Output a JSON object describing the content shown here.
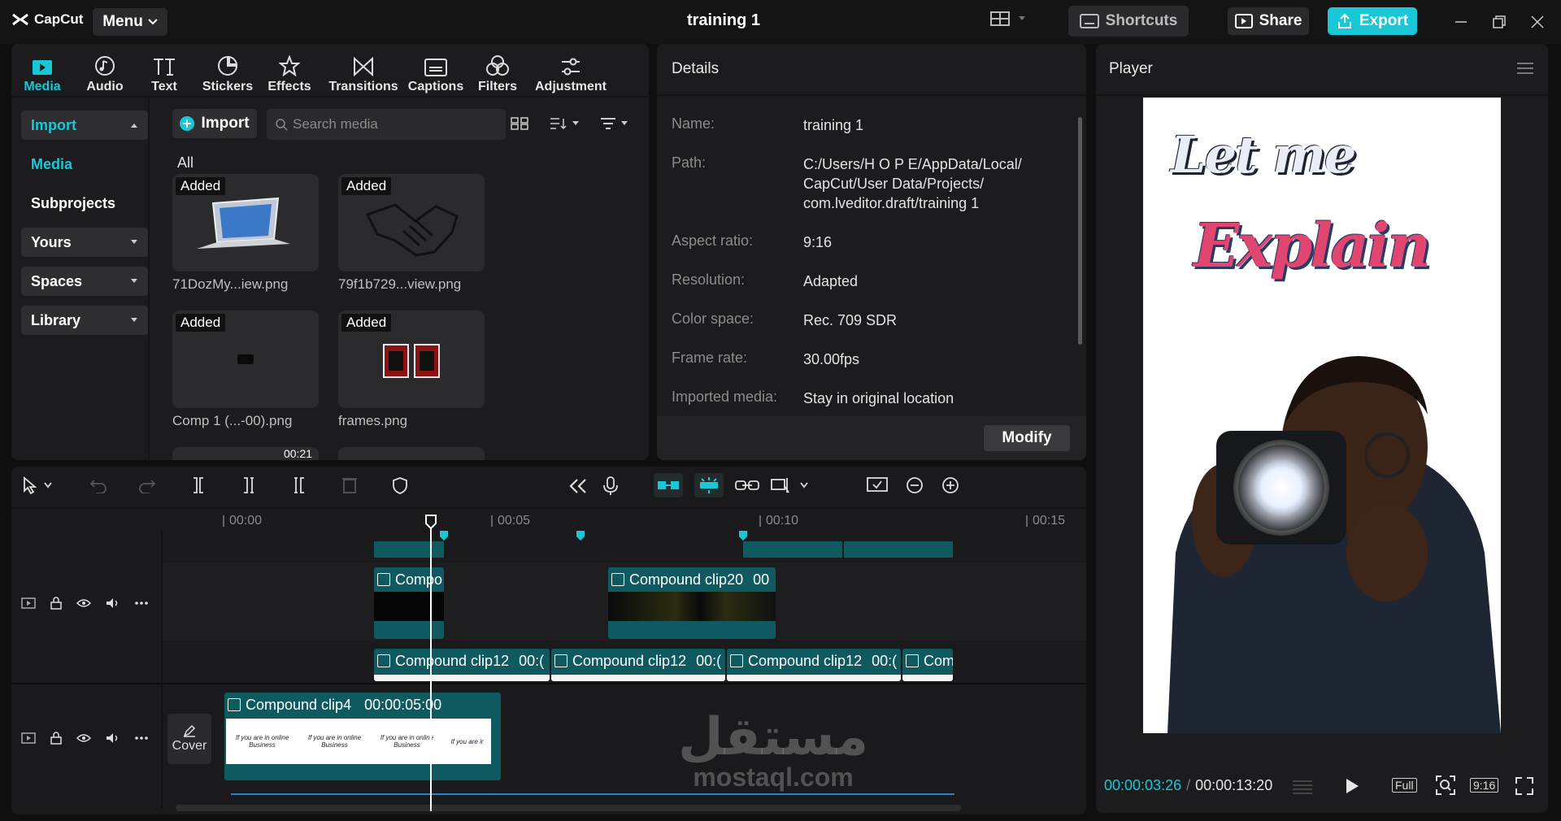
{
  "titlebar": {
    "app_name": "CapCut",
    "menu_label": "Menu",
    "project_title": "training 1",
    "shortcuts_label": "Shortcuts",
    "share_label": "Share",
    "export_label": "Export"
  },
  "toolbar": {
    "items": [
      {
        "label": "Media",
        "icon": "media-icon"
      },
      {
        "label": "Audio",
        "icon": "audio-icon"
      },
      {
        "label": "Text",
        "icon": "text-icon"
      },
      {
        "label": "Stickers",
        "icon": "stickers-icon"
      },
      {
        "label": "Effects",
        "icon": "effects-icon"
      },
      {
        "label": "Transitions",
        "icon": "transitions-icon"
      },
      {
        "label": "Captions",
        "icon": "captions-icon"
      },
      {
        "label": "Filters",
        "icon": "filters-icon"
      },
      {
        "label": "Adjustment",
        "icon": "adjustment-icon"
      }
    ]
  },
  "sidebar": {
    "import": "Import",
    "media": "Media",
    "subprojects": "Subprojects",
    "yours": "Yours",
    "spaces": "Spaces",
    "library": "Library"
  },
  "media": {
    "import_button": "Import",
    "search_placeholder": "Search media",
    "filter_label": "All",
    "badge": "Added",
    "items": [
      {
        "name": "71DozMy...iew.png"
      },
      {
        "name": "79f1b729...view.png"
      },
      {
        "name": "Comp 1 (...-00).png"
      },
      {
        "name": "frames.png"
      }
    ],
    "partial_duration": "00:21"
  },
  "details": {
    "title": "Details",
    "rows": [
      {
        "label": "Name:",
        "value": "training 1"
      },
      {
        "label": "Path:",
        "value": "C:/Users/H O P E/AppData/Local/ CapCut/User Data/Projects/ com.lveditor.draft/training 1"
      },
      {
        "label": "Aspect ratio:",
        "value": "9:16"
      },
      {
        "label": "Resolution:",
        "value": "Adapted"
      },
      {
        "label": "Color space:",
        "value": "Rec. 709 SDR"
      },
      {
        "label": "Frame rate:",
        "value": "30.00fps"
      },
      {
        "label": "Imported media:",
        "value": "Stay in original location"
      }
    ],
    "modify_label": "Modify"
  },
  "player": {
    "title": "Player",
    "preview_line1": "Let me",
    "preview_line2": "Explain",
    "current_time": "00:00:03:26",
    "total_time": "00:00:13:20",
    "full_label": "Full",
    "ratio_label": "9:16"
  },
  "timeline": {
    "ruler": [
      "00:00",
      "00:05",
      "00:10",
      "00:15"
    ],
    "clips_track1": [
      {
        "label": "Compo"
      },
      {
        "label": "Compound clip20",
        "time": "00"
      }
    ],
    "clips_track2": [
      {
        "label": "Compound clip12",
        "time": "00:("
      },
      {
        "label": "Compound clip12",
        "time": "00:("
      },
      {
        "label": "Compound clip12",
        "time": "00:("
      },
      {
        "label": "Com",
        "time": ""
      }
    ],
    "main_clip": {
      "label": "Compound clip4",
      "time": "00:00:05:00"
    },
    "main_clip_text": "If you are in online Business",
    "cover_label": "Cover"
  },
  "watermark": {
    "arabic": "مستقل",
    "latin": "mostaql.com"
  },
  "colors": {
    "accent": "#19c7d6",
    "track_teal": "#0e5a60"
  }
}
